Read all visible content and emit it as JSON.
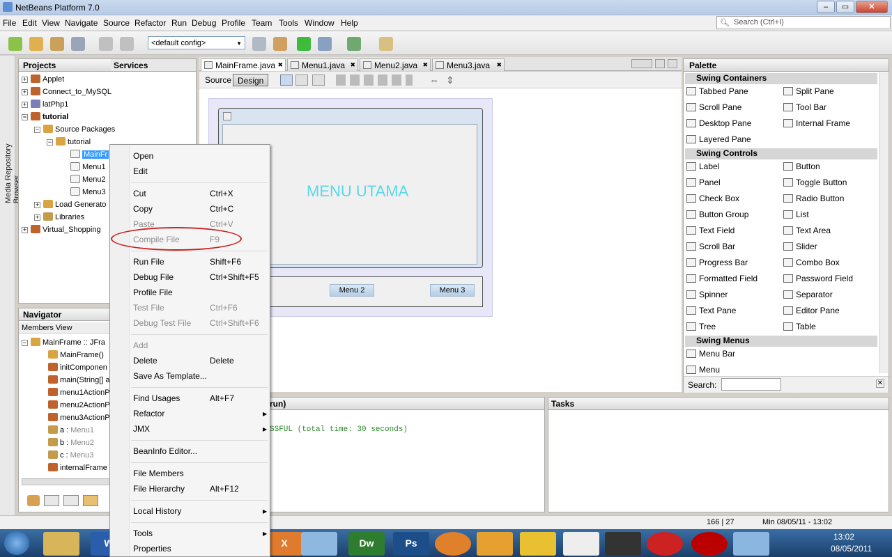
{
  "window": {
    "title": "NetBeans Platform 7.0",
    "controls": [
      "–",
      "▭",
      "✕"
    ]
  },
  "menubar": [
    "File",
    "Edit",
    "View",
    "Navigate",
    "Source",
    "Refactor",
    "Run",
    "Debug",
    "Profile",
    "Team",
    "Tools",
    "Window",
    "Help"
  ],
  "search": {
    "placeholder": "Search (Ctrl+I)"
  },
  "toolbar": {
    "config": "<default config>"
  },
  "leftstrip": {
    "label": "Media Repository Browser"
  },
  "projects": {
    "title": "Projects",
    "services_tab": "Services",
    "items": [
      {
        "label": "Applet"
      },
      {
        "label": "Connect_to_MySQL"
      },
      {
        "label": "latPhp1"
      },
      {
        "label": "tutorial"
      },
      {
        "label": "Source Packages"
      },
      {
        "label": "tutorial"
      },
      {
        "label": "MainFr"
      },
      {
        "label": "Menu1"
      },
      {
        "label": "Menu2"
      },
      {
        "label": "Menu3"
      },
      {
        "label": "Load Generato"
      },
      {
        "label": "Libraries"
      },
      {
        "label": "Virtual_Shopping"
      }
    ]
  },
  "navigator": {
    "title": "Navigator",
    "view": "Members View",
    "items": [
      {
        "label": "MainFrame :: JFra"
      },
      {
        "label": "MainFrame()"
      },
      {
        "label": "initComponen"
      },
      {
        "label": "main(String[] a"
      },
      {
        "label": "menu1ActionP"
      },
      {
        "label": "menu2ActionP"
      },
      {
        "label": "menu3ActionP"
      },
      {
        "label": "a : ",
        "type": "Menu1"
      },
      {
        "label": "b : ",
        "type": "Menu2"
      },
      {
        "label": "c : ",
        "type": "Menu3"
      },
      {
        "label": "internalFrame"
      }
    ]
  },
  "editor": {
    "tabs": [
      "MainFrame.java",
      "Menu1.java",
      "Menu2.java",
      "Menu3.java"
    ],
    "source_label": "Source",
    "design_label": "Design",
    "form_title": "MENU UTAMA",
    "menu_buttons": [
      "Menu 2",
      "Menu 3"
    ]
  },
  "palette": {
    "title": "Palette",
    "sections": [
      {
        "name": "Swing Containers",
        "items": [
          "Tabbed Pane",
          "Split Pane",
          "Scroll Pane",
          "Tool Bar",
          "Desktop Pane",
          "Internal Frame",
          "Layered Pane"
        ]
      },
      {
        "name": "Swing Controls",
        "items": [
          "Label",
          "Button",
          "Panel",
          "Toggle Button",
          "Check Box",
          "Radio Button",
          "Button Group",
          "List",
          "Text Field",
          "Text Area",
          "Scroll Bar",
          "Slider",
          "Progress Bar",
          "Combo Box",
          "Formatted Field",
          "Password Field",
          "Spinner",
          "Separator",
          "Text Pane",
          "Editor Pane",
          "Tree",
          "Table"
        ]
      },
      {
        "name": "Swing Menus",
        "items": [
          "Menu Bar",
          "Menu"
        ]
      }
    ],
    "search_label": "Search:"
  },
  "output": {
    "title": "run)",
    "text": "SSFUL (total time: 30 seconds)"
  },
  "tasks": {
    "title": "Tasks"
  },
  "statusbar": {
    "position": "166 | 27",
    "memory": "Min 08/05/11 - 13:02"
  },
  "context_menu": [
    {
      "label": "Open"
    },
    {
      "label": "Edit"
    },
    {
      "sep": true
    },
    {
      "label": "Cut",
      "shortcut": "Ctrl+X"
    },
    {
      "label": "Copy",
      "shortcut": "Ctrl+C"
    },
    {
      "label": "Paste",
      "shortcut": "Ctrl+V",
      "disabled": true
    },
    {
      "label": "Compile File",
      "shortcut": "F9",
      "disabled": true
    },
    {
      "sep": true
    },
    {
      "label": "Run File",
      "shortcut": "Shift+F6"
    },
    {
      "label": "Debug File",
      "shortcut": "Ctrl+Shift+F5"
    },
    {
      "label": "Profile File"
    },
    {
      "label": "Test File",
      "shortcut": "Ctrl+F6",
      "disabled": true
    },
    {
      "label": "Debug Test File",
      "shortcut": "Ctrl+Shift+F6",
      "disabled": true
    },
    {
      "sep": true
    },
    {
      "label": "Add",
      "disabled": true
    },
    {
      "label": "Delete",
      "shortcut": "Delete"
    },
    {
      "label": "Save As Template..."
    },
    {
      "sep": true
    },
    {
      "label": "Find Usages",
      "shortcut": "Alt+F7"
    },
    {
      "label": "Refactor",
      "submenu": true
    },
    {
      "label": "JMX",
      "submenu": true
    },
    {
      "sep": true
    },
    {
      "label": "BeanInfo Editor..."
    },
    {
      "sep": true
    },
    {
      "label": "File Members"
    },
    {
      "label": "File Hierarchy",
      "shortcut": "Alt+F12"
    },
    {
      "sep": true
    },
    {
      "label": "Local History",
      "submenu": true
    },
    {
      "sep": true
    },
    {
      "label": "Tools",
      "submenu": true
    },
    {
      "label": "Properties"
    }
  ],
  "taskbar": {
    "time": "13:02",
    "date": "08/05/2011",
    "apps": [
      "Start",
      "Explorer",
      "Word",
      "XAMPP",
      "NetBeans",
      "Dreamweaver",
      "Photoshop",
      "Firefox",
      "Media",
      "Pidgin",
      "Notepad",
      "Game",
      "Smart",
      "Smartfren",
      "Paint"
    ]
  },
  "colors": {
    "highlight_circle": "#cc2222",
    "form_title": "#5ad8e8",
    "selected_node": "#3399ff"
  }
}
